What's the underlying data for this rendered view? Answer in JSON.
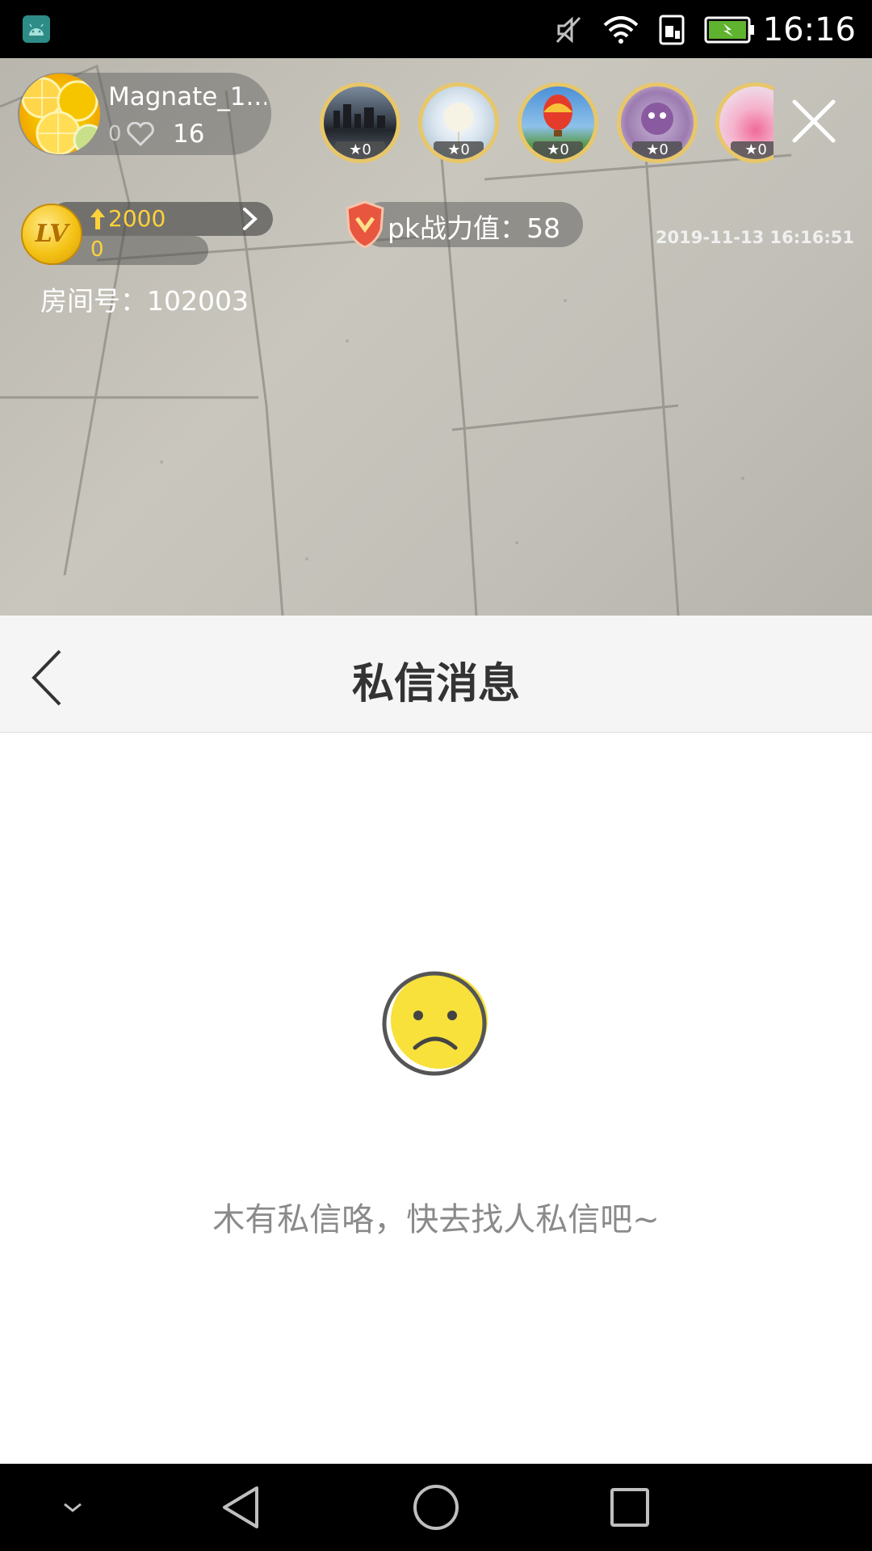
{
  "status_bar": {
    "time": "16:16",
    "icons": [
      "android-debug-icon",
      "mute-icon",
      "wifi-icon",
      "sim-icon",
      "battery-charging-icon"
    ]
  },
  "live_room": {
    "anchor_name": "Magnate_1...",
    "anchor_likes_prefix": "0",
    "anchor_likes": "16",
    "viewers": [
      {
        "badge": "0"
      },
      {
        "badge": "0"
      },
      {
        "badge": "0"
      },
      {
        "badge": "0"
      },
      {
        "badge": "0"
      }
    ],
    "level_points": "2000",
    "level_value": "0",
    "level_badge": "LV",
    "pk_label": "pk战力值：",
    "pk_value": "58",
    "timestamp": "2019-11-13 16:16:51",
    "room_number": "房间号：102003"
  },
  "messages_panel": {
    "title": "私信消息",
    "empty_text": "木有私信咯，快去找人私信吧~"
  },
  "nav_bar": {
    "buttons": [
      "hide-keyboard",
      "back",
      "home",
      "recents"
    ]
  },
  "colors": {
    "accent_yellow": "#ffd23b",
    "face_yellow": "#f7e13a",
    "header_bg": "#f5f5f5"
  }
}
